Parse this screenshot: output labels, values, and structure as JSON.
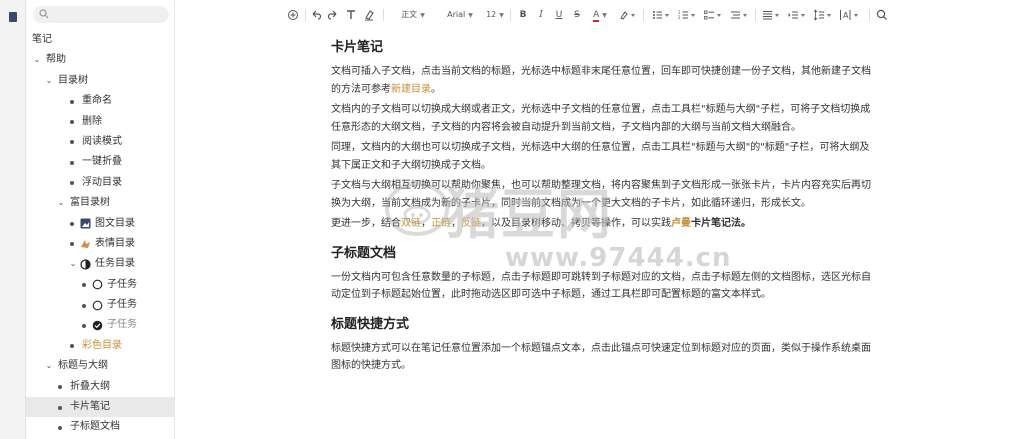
{
  "sidebar": {
    "search_placeholder": "",
    "items": [
      {
        "label": "笔记"
      },
      {
        "label": "帮助"
      },
      {
        "label": "目录树"
      },
      {
        "label": "重命名"
      },
      {
        "label": "删除"
      },
      {
        "label": "阅读模式"
      },
      {
        "label": "一键折叠"
      },
      {
        "label": "浮动目录"
      },
      {
        "label": "富目录树"
      },
      {
        "label": "图文目录"
      },
      {
        "label": "表情目录"
      },
      {
        "label": "任务目录"
      },
      {
        "label": "子任务"
      },
      {
        "label": "子任务"
      },
      {
        "label": "子任务"
      },
      {
        "label": "彩色目录"
      },
      {
        "label": "标题与大纲"
      },
      {
        "label": "折叠大纲"
      },
      {
        "label": "卡片笔记"
      },
      {
        "label": "子标题文档"
      }
    ]
  },
  "toolbar": {
    "style_select": "正文",
    "font_select": "Arial",
    "size_select": "12"
  },
  "doc": {
    "h1": "卡片笔记",
    "p1a": "文档可插入子文档，点击当前文档的标题，光标选中标题非末尾任意位置，回车即可快捷创建一份子文档，其他新建子文档的方法可参考",
    "p1link": "新建目录",
    "p1b": "。",
    "p2": "文档内的子文档可以切换成大纲或者正文，光标选中子文档的任意位置，点击工具栏\"标题与大纲\"子栏，可将子文档切换成任意形态的大纲文档，子文档的内容将会被自动提升到当前文档，子文档内部的大纲与当前文档大纲融合。",
    "p3": "同理，文档内的大纲也可以切换成子文档，光标选中大纲的任意位置，点击工具栏\"标题与大纲\"的\"标题\"子栏，可将大纲及其下属正文和子大纲切换成子文档。",
    "p4": "子文档与大纲相互切换可以帮助你聚焦，也可以帮助整理文档，将内容聚焦到子文档形成一张张卡片，卡片内容充实后再切换为大纲，当前文档成为新的子卡片，同时当前文档成为一个更大文档的子卡片，如此循环递归，形成长文。",
    "p5a": "更进一步，结合",
    "p5l1": "双链",
    "p5s1": "，",
    "p5l2": "正链",
    "p5s2": "，",
    "p5l3": "反链",
    "p5b": "，以及目录树移动、拷贝等操作，可以实践",
    "p5l4": "卢曼",
    "p5c": "卡片笔记法。",
    "h2": "子标题文档",
    "p6": "一份文档内可包含任意数量的子标题，点击子标题即可跳转到子标题对应的文档，点击子标题左侧的文档图标，选区光标自动定位到子标题起始位置，此时拖动选区即可选中子标题，通过工具栏即可配置标题的富文本样式。",
    "h3": "标题快捷方式",
    "p7": "标题快捷方式可以在笔记任意位置添加一个标题锚点文本，点击此锚点可快速定位到标题对应的页面，类似于操作系统桌面图标的快捷方式。"
  },
  "watermark": {
    "text1": "猪豆网",
    "text2": "www.97444.cn"
  }
}
